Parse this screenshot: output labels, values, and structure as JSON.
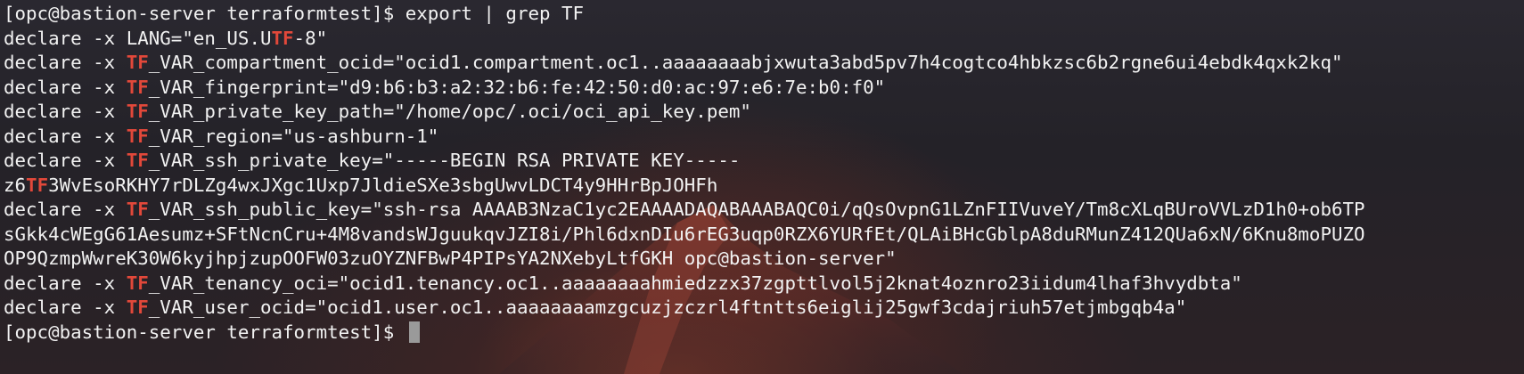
{
  "terminal": {
    "highlight": "TF",
    "colors": {
      "text": "#f2f2f2",
      "highlight": "#e2483a",
      "cursor": "#9a9a9a"
    },
    "lines": [
      [
        "[opc@bastion-server terraformtest]$ export | grep TF"
      ],
      [
        "declare -x LANG=\"en_US.U",
        "TF",
        "-8\""
      ],
      [
        "declare -x ",
        "TF",
        "_VAR_compartment_ocid=\"ocid1.compartment.oc1..aaaaaaaabjxwuta3abd5pv7h4cogtco4hbkzsc6b2rgne6ui4ebdk4qxk2kq\""
      ],
      [
        "declare -x ",
        "TF",
        "_VAR_fingerprint=\"d9:b6:b3:a2:32:b6:fe:42:50:d0:ac:97:e6:7e:b0:f0\""
      ],
      [
        "declare -x ",
        "TF",
        "_VAR_private_key_path=\"/home/opc/.oci/oci_api_key.pem\""
      ],
      [
        "declare -x ",
        "TF",
        "_VAR_region=\"us-ashburn-1\""
      ],
      [
        "declare -x ",
        "TF",
        "_VAR_ssh_private_key=\"-----BEGIN RSA PRIVATE KEY-----"
      ],
      [
        "z6",
        "TF",
        "3WvEsoRKHY7rDLZg4wxJXgc1Uxp7JldieSXe3sbgUwvLDCT4y9HHrBpJOHFh"
      ],
      [
        "declare -x ",
        "TF",
        "_VAR_ssh_public_key=\"ssh-rsa AAAAB3NzaC1yc2EAAAADAQABAAABAQC0i/qQsOvpnG1LZnFIIVuveY/Tm8cXLqBUroVVLzD1h0+ob6TP"
      ],
      [
        "sGkk4cWEgG61Aesumz+SFtNcnCru+4M8vandsWJguukqvJZI8i/Phl6dxnDIu6rEG3uqp0RZX6YURfEt/QLAiBHcGblpA8duRMunZ412QUa6xN/6Knu8moPUZO"
      ],
      [
        "OP9QzmpWwreK30W6kyjhpjzupOOFW03zuOYZNFBwP4PIPsYA2NXebyLtfGKH opc@bastion-server\""
      ],
      [
        "declare -x ",
        "TF",
        "_VAR_tenancy_oci=\"ocid1.tenancy.oc1..aaaaaaaahmiedzzx37zgpttlvol5j2knat4oznro23iidum4lhaf3hvydbta\""
      ],
      [
        "declare -x ",
        "TF",
        "_VAR_user_ocid=\"ocid1.user.oc1..aaaaaaaamzgcuzjzczrl4ftntts6eiglij25gwf3cdajriuh57etjmbgqb4a\""
      ],
      [
        "[opc@bastion-server terraformtest]$ "
      ]
    ]
  }
}
